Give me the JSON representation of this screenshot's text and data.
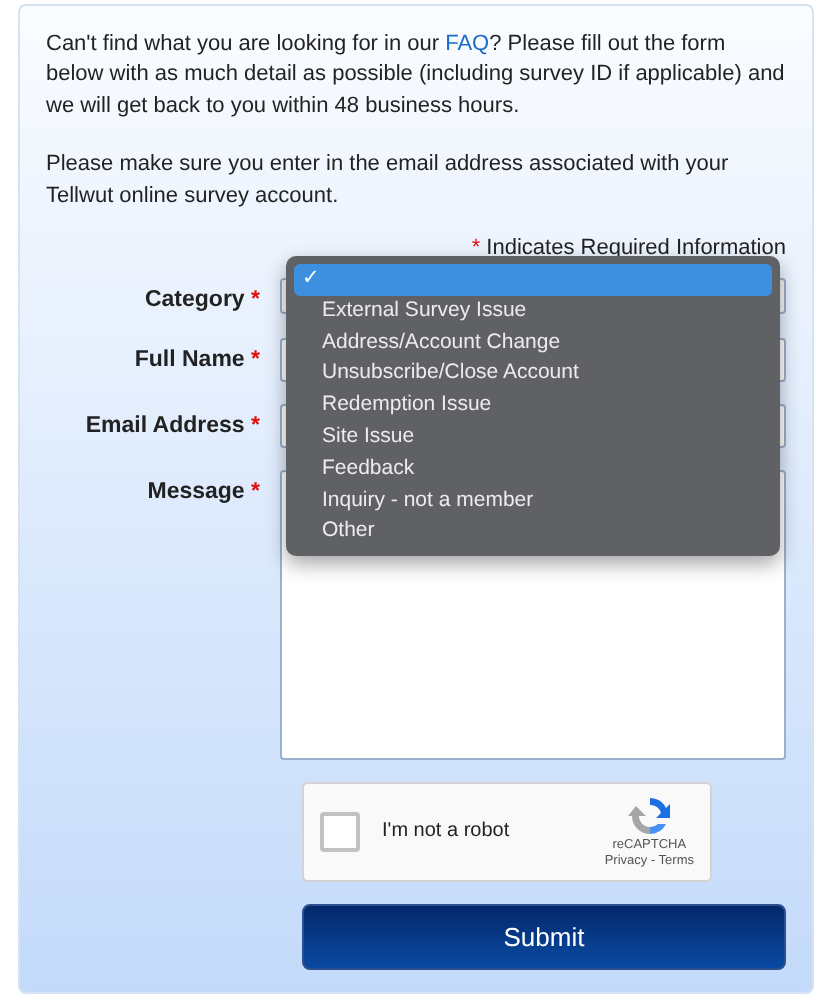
{
  "intro": {
    "before": "Can't find what you are looking for in our ",
    "link": "FAQ",
    "after": "? Please fill out the form below with as much detail as possible (including survey ID if applicable) and we will get back to you within 48 business hours."
  },
  "note": "Please make sure you enter in the email address associated with your Tellwut online survey account.",
  "required_note": {
    "mark": "*",
    "text": "Indicates Required Information"
  },
  "fields": [
    {
      "label": "Category",
      "mark": "*",
      "kind": "select"
    },
    {
      "label": "Full Name",
      "mark": "*",
      "kind": "text"
    },
    {
      "label": "Email Address",
      "mark": "*",
      "kind": "text"
    },
    {
      "label": "Message",
      "mark": "*",
      "kind": "textarea"
    }
  ],
  "dropdown": {
    "check_mark": "✓",
    "options": [
      {
        "selected": true
      },
      {
        "label": "External Survey Issue",
        "selected": false
      },
      {
        "label": "Address/Account Change",
        "selected": false
      },
      {
        "label": "Unsubscribe/Close Account",
        "selected": false
      },
      {
        "label": "Redemption Issue",
        "selected": false
      },
      {
        "label": "Site Issue",
        "selected": false
      },
      {
        "label": "Feedback",
        "selected": false
      },
      {
        "label": "Inquiry - not a member",
        "selected": false
      },
      {
        "label": "Other",
        "selected": false
      }
    ]
  },
  "captcha": {
    "checked": false,
    "label": "I'm not a robot",
    "brand": "reCAPTCHA",
    "links": "Privacy - Terms"
  },
  "submit": "Submit"
}
